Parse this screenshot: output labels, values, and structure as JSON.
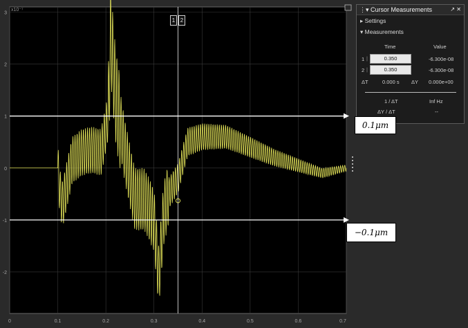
{
  "plot": {
    "exponent_label": "x10⁻⁷",
    "x_ticks": [
      "0",
      "0.1",
      "0.2",
      "0.3",
      "0.4",
      "0.5",
      "0.6",
      "0.7"
    ],
    "y_ticks": [
      "3",
      "2",
      "1",
      "0",
      "-1",
      "-2"
    ],
    "trace_color": "#e6e65a",
    "background": "#000000",
    "grid_color": "#3a3a3a",
    "cursor_tags": [
      "1",
      "2"
    ]
  },
  "chart_data": {
    "type": "line",
    "title": "",
    "xlabel": "",
    "ylabel": "",
    "xlim": [
      0,
      0.7
    ],
    "ylim": [
      -2.8,
      3.1
    ],
    "y_scale_factor": "1e-7",
    "grid": true,
    "series": [
      {
        "x": [
          0,
          0.1,
          0.105,
          0.11,
          0.13,
          0.15,
          0.17,
          0.19,
          0.205,
          0.21,
          0.215,
          0.22,
          0.24,
          0.26,
          0.28,
          0.3,
          0.31,
          0.32,
          0.33,
          0.35,
          0.37,
          0.4,
          0.45,
          0.5,
          0.55,
          0.6,
          0.65,
          0.7
        ],
        "y": [
          0,
          0,
          -0.5,
          -0.7,
          0.15,
          0.3,
          0.35,
          0.3,
          1.0,
          2.6,
          2.0,
          1.4,
          0.3,
          -0.6,
          -0.6,
          -1.0,
          -2.1,
          -0.9,
          -0.5,
          -0.2,
          0.5,
          0.6,
          0.6,
          0.4,
          0.2,
          0.05,
          -0.1,
          0
        ]
      }
    ],
    "reference_lines": [
      {
        "y": 1,
        "label": "0.1μm"
      },
      {
        "y": -1,
        "label": "−0.1μm"
      }
    ],
    "cursor_x": 0.35
  },
  "callouts": {
    "upper": "0.1μm",
    "lower": "−0.1μm"
  },
  "cursor_panel": {
    "title": "Cursor Measurements",
    "controls": "↗ ✕",
    "settings_label": "Settings",
    "measurements_label": "Measurements",
    "col_time": "Time",
    "col_value": "Value",
    "row1_label": "1",
    "row1_time": "0.350",
    "row1_value": "-6.300e-08",
    "row2_label": "2",
    "row2_time": "0.350",
    "row2_value": "-6.300e-08",
    "delta_t_label": "ΔT",
    "delta_t_value": "0.000 s",
    "delta_y_label": "ΔY",
    "delta_y_value": "0.000e+00",
    "freq_label": "1 / ΔT",
    "freq_value": "Inf Hz",
    "slope_label": "ΔY / ΔT",
    "slope_value": "--"
  }
}
